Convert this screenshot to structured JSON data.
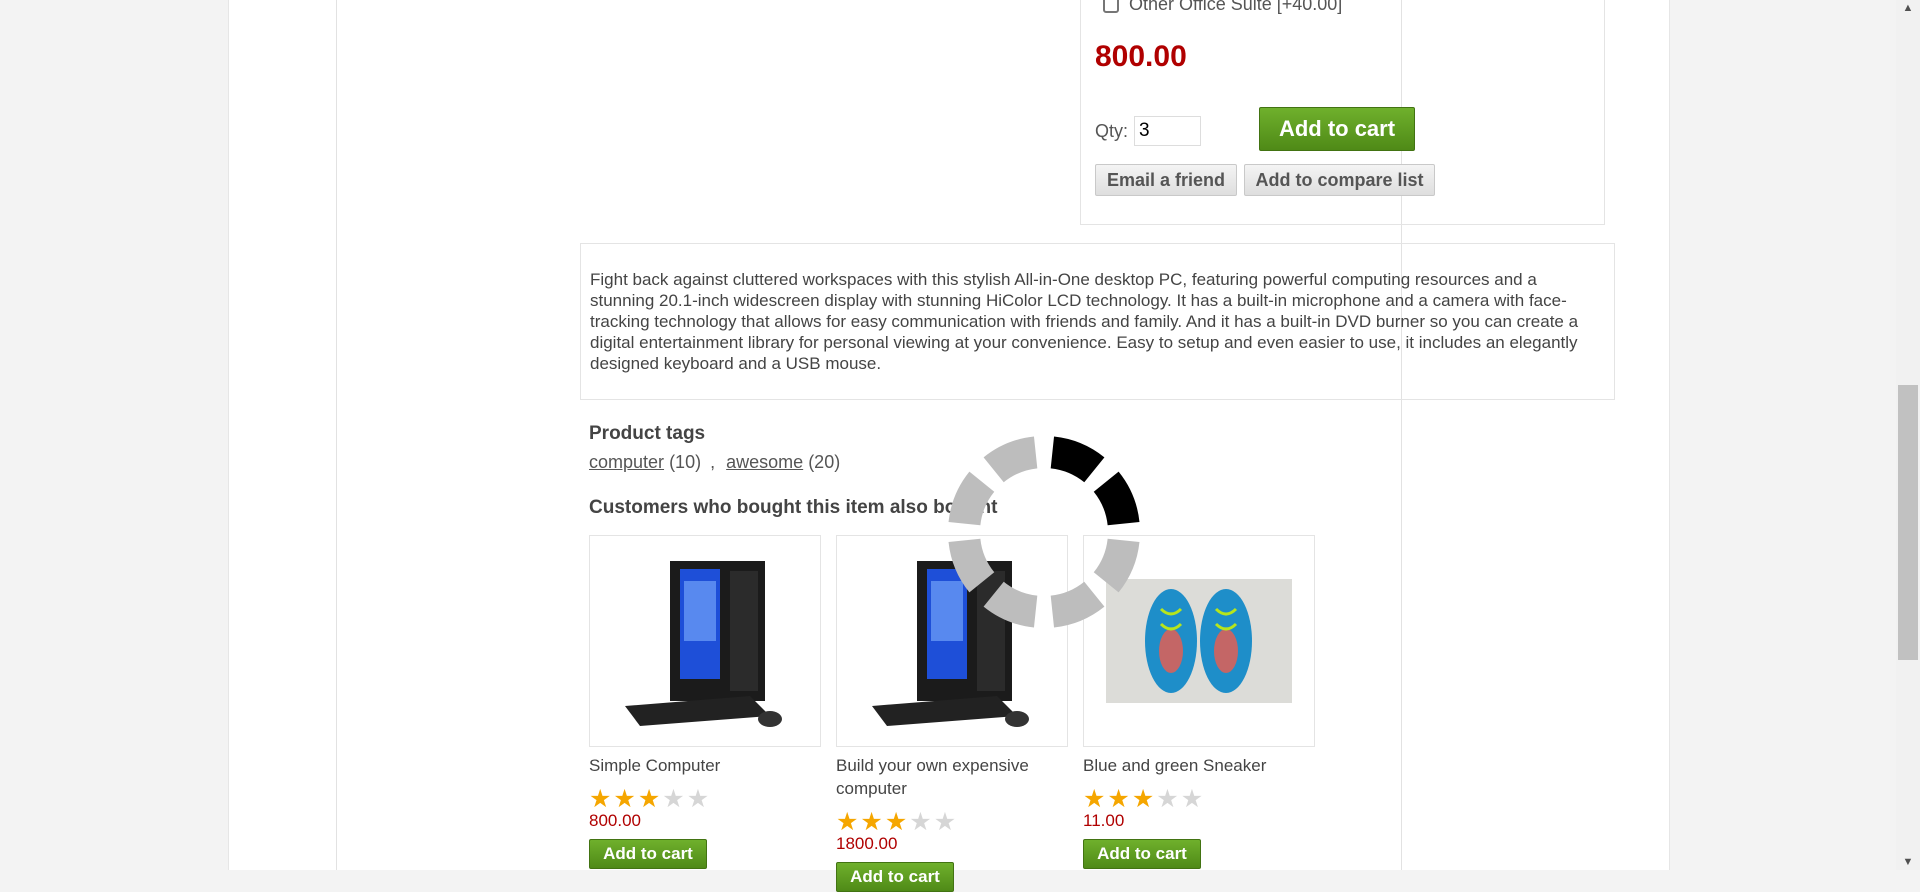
{
  "product": {
    "option_label": "Other Office Suite [+40.00]",
    "price": "800.00",
    "qty_label": "Qty:",
    "qty_value": "3",
    "add_to_cart": "Add to cart",
    "email_friend": "Email a friend",
    "compare": "Add to compare list",
    "description": "Fight back against cluttered workspaces with this stylish All-in-One desktop PC, featuring powerful computing resources and a stunning 20.1-inch widescreen display with stunning HiColor LCD technology. It has a built-in microphone and a camera with face-tracking technology that allows for easy communication with friends and family. And it has a built-in DVD burner so you can create a digital entertainment library for personal viewing at your convenience. Easy to setup and even easier to use, it includes an elegantly designed keyboard and a USB mouse."
  },
  "tags": {
    "title": "Product tags",
    "items": [
      {
        "name": "computer",
        "count": "(10)"
      },
      {
        "name": "awesome",
        "count": "(20)"
      }
    ],
    "separator": ","
  },
  "also_bought": {
    "title": "Customers who bought this item also bought",
    "items": [
      {
        "name": "Simple Computer",
        "price": "800.00",
        "rating": 3,
        "image": "desktop-computer-image",
        "button": "Add to cart"
      },
      {
        "name": "Build your own expensive computer",
        "price": "1800.00",
        "rating": 3,
        "image": "desktop-computer-image",
        "button": "Add to cart"
      },
      {
        "name": "Blue and green Sneaker",
        "price": "11.00",
        "rating": 3,
        "image": "sneaker-image",
        "button": "Add to cart"
      }
    ]
  },
  "overlay": {
    "icon": "loading-spinner-icon"
  },
  "colors": {
    "price": "#b00000",
    "button_green": "#5a9a1f",
    "star": "#f5a600"
  }
}
